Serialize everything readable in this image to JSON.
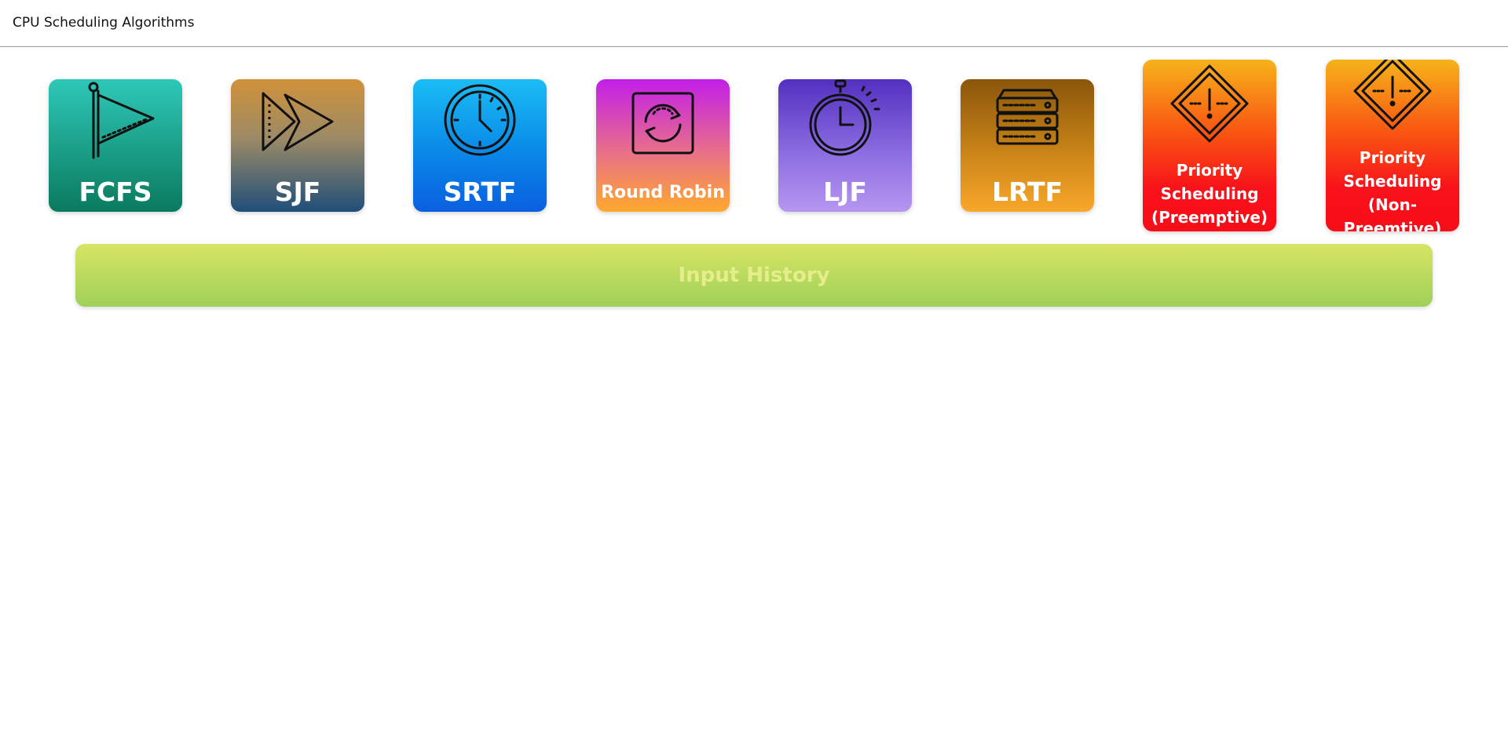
{
  "header": {
    "title": "CPU Scheduling Algorithms"
  },
  "algorithms": [
    {
      "id": "fcfs",
      "label": "FCFS",
      "icon": "flag-icon"
    },
    {
      "id": "sjf",
      "label": "SJF",
      "icon": "fast-forward-icon"
    },
    {
      "id": "srtf",
      "label": "SRTF",
      "icon": "clock-icon"
    },
    {
      "id": "rr",
      "label": "Round Robin",
      "icon": "refresh-cycle-icon"
    },
    {
      "id": "ljf",
      "label": "LJF",
      "icon": "stopwatch-icon"
    },
    {
      "id": "lrtf",
      "label": "LRTF",
      "icon": "server-stack-icon"
    },
    {
      "id": "ps-pre",
      "label_lines": [
        "Priority",
        "Scheduling",
        "(Preemptive)"
      ],
      "icon": "warning-sign-icon"
    },
    {
      "id": "ps-np",
      "label_lines": [
        "Priority",
        "Scheduling",
        "(Non-",
        "Preemtive)"
      ],
      "icon": "warning-sign-icon"
    }
  ],
  "history": {
    "label": "Input History"
  }
}
